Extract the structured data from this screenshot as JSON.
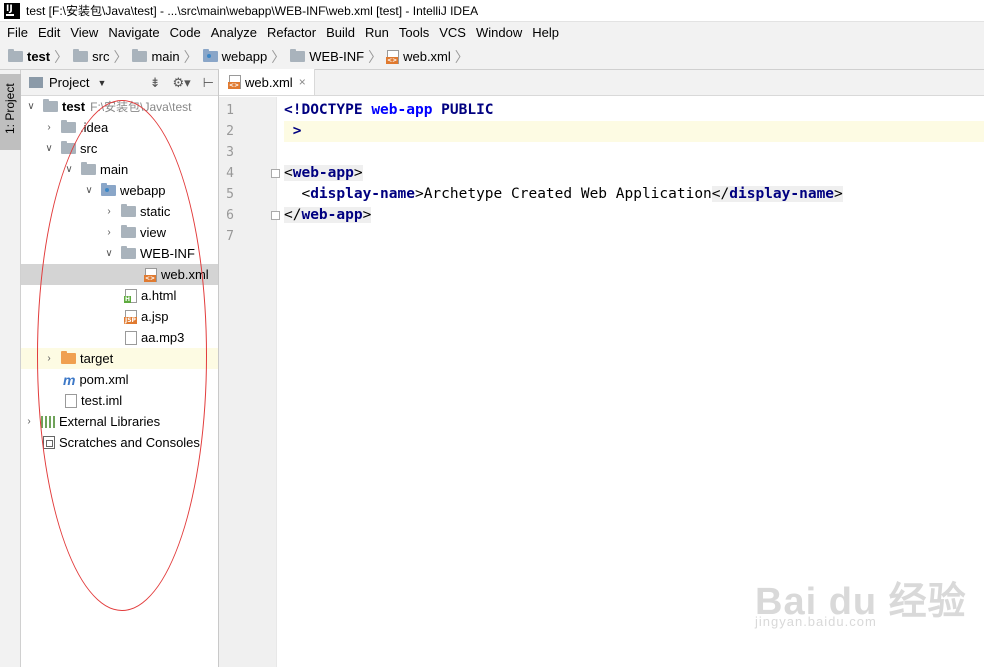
{
  "window": {
    "title": "test [F:\\安装包\\Java\\test] - ...\\src\\main\\webapp\\WEB-INF\\web.xml [test] - IntelliJ IDEA",
    "app_icon": "IJ"
  },
  "menu": [
    "File",
    "Edit",
    "View",
    "Navigate",
    "Code",
    "Analyze",
    "Refactor",
    "Build",
    "Run",
    "Tools",
    "VCS",
    "Window",
    "Help"
  ],
  "breadcrumbs": [
    "test",
    "src",
    "main",
    "webapp",
    "WEB-INF",
    "web.xml"
  ],
  "left_strip": {
    "tab_label": "1: Project"
  },
  "project_panel": {
    "header": "Project",
    "tree": [
      {
        "label": "test",
        "path": "F:\\安装包\\Java\\test"
      },
      {
        "label": ".idea"
      },
      {
        "label": "src"
      },
      {
        "label": "main"
      },
      {
        "label": "webapp"
      },
      {
        "label": "static"
      },
      {
        "label": "view"
      },
      {
        "label": "WEB-INF"
      },
      {
        "label": "web.xml"
      },
      {
        "label": "a.html"
      },
      {
        "label": "a.jsp"
      },
      {
        "label": "aa.mp3"
      },
      {
        "label": "target"
      },
      {
        "label": "pom.xml"
      },
      {
        "label": "test.iml"
      },
      {
        "label": "External Libraries"
      },
      {
        "label": "Scratches and Consoles"
      }
    ]
  },
  "editor": {
    "tab": {
      "label": "web.xml",
      "close": "×"
    },
    "line_numbers": [
      "1",
      "2",
      "3",
      "4",
      "5",
      "6",
      "7"
    ],
    "lines": {
      "l1_a": "<!",
      "l1_b": "DOCTYPE",
      "l1_c": "web-app",
      "l1_d": "PUBLIC",
      "l2": " >",
      "l4_a": "<",
      "l4_b": "web-app",
      "l4_c": ">",
      "l5_a": "  <",
      "l5_b": "display-name",
      "l5_c": ">",
      "l5_text": "Archetype Created Web Application",
      "l5_d": "</",
      "l5_e": "display-name",
      "l5_f": ">",
      "l6_a": "</",
      "l6_b": "web-app",
      "l6_c": ">"
    }
  },
  "watermark": {
    "brand": "Bai du 经验",
    "url": "jingyan.baidu.com"
  },
  "colors": {
    "keyword": "#000080",
    "annotation_circle": "#e23b3b",
    "current_line": "#fdfbe3",
    "selection": "#d4d4d4"
  }
}
